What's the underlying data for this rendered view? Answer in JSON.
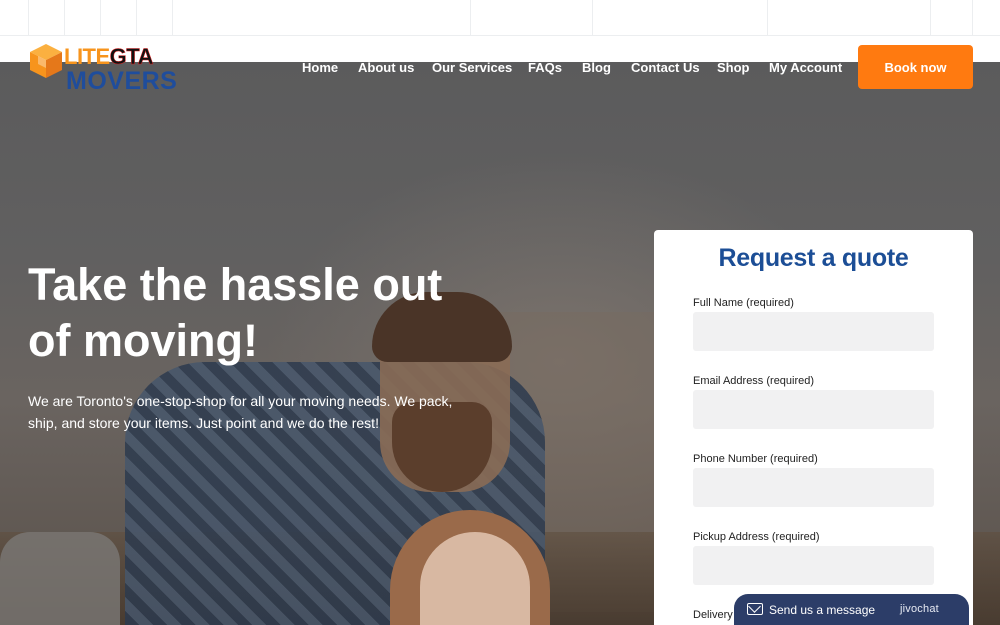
{
  "logo": {
    "lite": "LITE",
    "gta": "GTA",
    "movers": "MOVERS"
  },
  "nav": {
    "items": [
      {
        "label": "Home"
      },
      {
        "label": "About us"
      },
      {
        "label": "Our Services"
      },
      {
        "label": "FAQs"
      },
      {
        "label": "Blog"
      },
      {
        "label": "Contact Us"
      },
      {
        "label": "Shop"
      },
      {
        "label": "My Account"
      }
    ],
    "cta_label": "Book now"
  },
  "hero": {
    "headline_line1": "Take the hassle out",
    "headline_line2": "of moving!",
    "subtext_line1": "We are Toronto's one-stop-shop for all your moving needs. We pack,",
    "subtext_line2": "ship, and store your items. Just point and we do the rest!"
  },
  "quote_form": {
    "title": "Request a quote",
    "fields": [
      {
        "label": "Full Name (required)",
        "value": ""
      },
      {
        "label": "Email Address (required)",
        "value": ""
      },
      {
        "label": "Phone Number (required)",
        "value": ""
      },
      {
        "label": "Pickup Address (required)",
        "value": ""
      },
      {
        "label": "Delivery"
      }
    ]
  },
  "chat": {
    "label": "Send us a message",
    "brand": "jivochat"
  },
  "colors": {
    "accent_orange": "#ff7a10",
    "brand_blue": "#1c4e96",
    "chat_navy": "#2c3d68"
  }
}
